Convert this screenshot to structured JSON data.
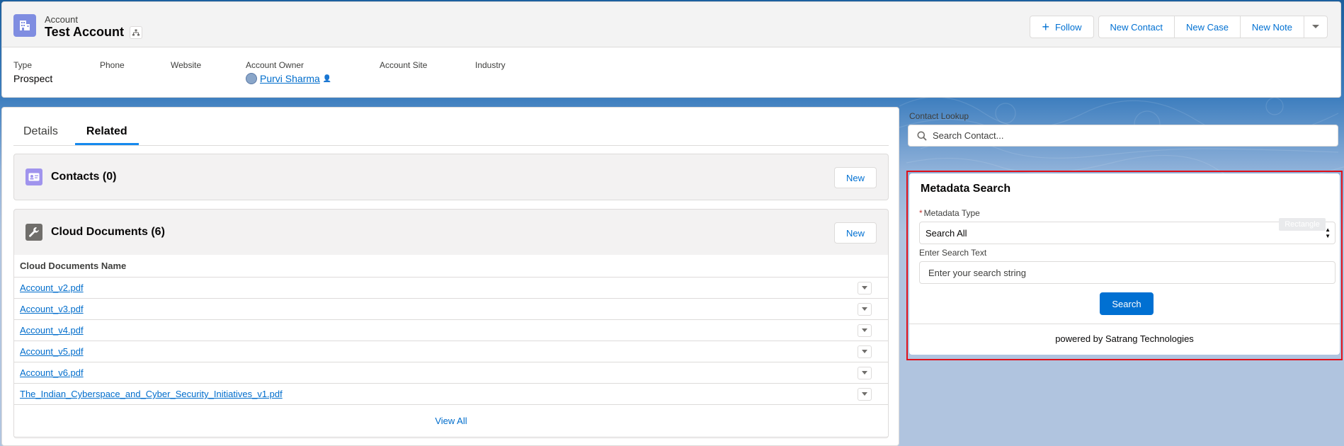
{
  "colors": {
    "brand_blue": "#0070d2",
    "link_blue": "#006dcc",
    "account_icon_bg": "#7f8de1",
    "contacts_icon_bg": "#a094ed",
    "cloud_docs_icon_bg": "#706e6b",
    "highlight_red": "#e0101a",
    "tab_active": "#1589ee"
  },
  "header": {
    "object_label": "Account",
    "title": "Test Account",
    "icon": "account-building-icon",
    "actions": {
      "follow_label": "Follow",
      "new_contact_label": "New Contact",
      "new_case_label": "New Case",
      "new_note_label": "New Note"
    },
    "fields": {
      "type_label": "Type",
      "type_value": "Prospect",
      "phone_label": "Phone",
      "website_label": "Website",
      "owner_label": "Account Owner",
      "owner_value": "Purvi Sharma",
      "site_label": "Account Site",
      "industry_label": "Industry"
    }
  },
  "tabs": {
    "details": "Details",
    "related": "Related"
  },
  "contacts": {
    "title": "Contacts (0)",
    "new_label": "New"
  },
  "cloud_documents": {
    "title": "Cloud Documents (6)",
    "new_label": "New",
    "column_header": "Cloud Documents Name",
    "rows": [
      "Account_v2.pdf",
      "Account_v3.pdf",
      "Account_v4.pdf",
      "Account_v5.pdf",
      "Account_v6.pdf",
      "The_Indian_Cyberspace_and_Cyber_Security_Initiatives_v1.pdf"
    ],
    "view_all_label": "View All"
  },
  "contact_lookup": {
    "label": "Contact Lookup",
    "placeholder": "Search Contact..."
  },
  "metadata_search": {
    "title": "Metadata Search",
    "required_marker": "*",
    "type_label": "Metadata Type",
    "type_value": "Search All",
    "overlay_tag": "Rectangle",
    "text_label": "Enter Search Text",
    "text_placeholder": "Enter your search string",
    "search_label": "Search",
    "footer": "powered by Satrang Technologies"
  }
}
